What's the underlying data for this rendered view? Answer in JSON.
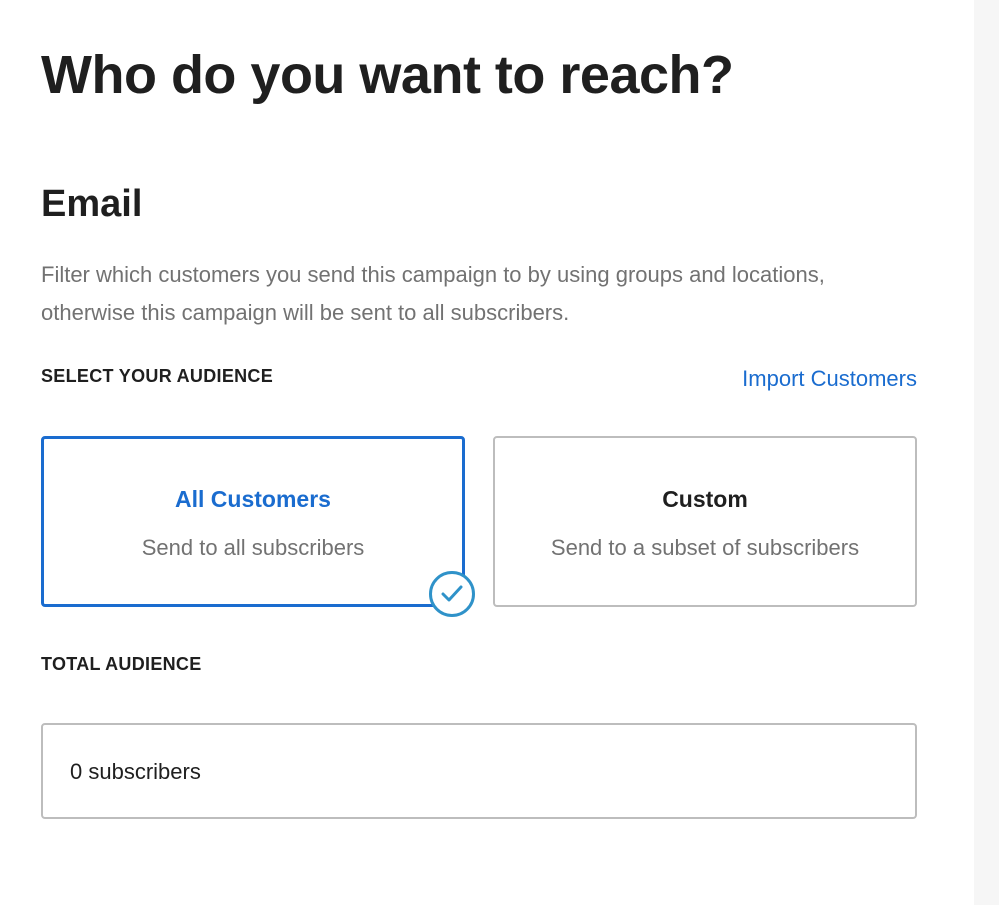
{
  "header": {
    "title": "Who do you want to reach?"
  },
  "email_section": {
    "title": "Email",
    "description": "Filter which customers you send this campaign to by using groups and locations, otherwise this campaign will be sent to all subscribers."
  },
  "audience": {
    "select_label": "SELECT YOUR AUDIENCE",
    "import_link": "Import Customers",
    "options": [
      {
        "title": "All Customers",
        "subtitle": "Send to all subscribers",
        "selected": true
      },
      {
        "title": "Custom",
        "subtitle": "Send to a subset of subscribers",
        "selected": false
      }
    ],
    "selected_icon": "check-circle-icon"
  },
  "total": {
    "label": "TOTAL AUDIENCE",
    "value": "0 subscribers"
  },
  "colors": {
    "accent": "#1a6ccf",
    "check": "#2f92c9",
    "text": "#1f1f1f",
    "muted": "#727272",
    "border": "#bdbdbd"
  }
}
